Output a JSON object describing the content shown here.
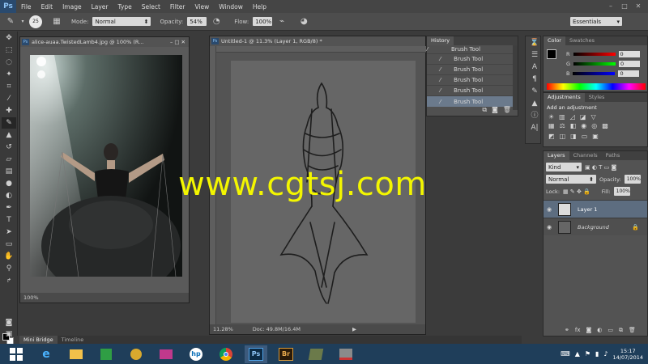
{
  "menubar": {
    "logo": "Ps",
    "items": [
      "File",
      "Edit",
      "Image",
      "Layer",
      "Type",
      "Select",
      "Filter",
      "View",
      "Window",
      "Help"
    ]
  },
  "options": {
    "brush_size": "25",
    "mode_label": "Mode:",
    "mode_value": "Normal",
    "opacity_label": "Opacity:",
    "opacity_value": "54%",
    "flow_label": "Flow:",
    "flow_value": "100%",
    "workspace": "Essentials"
  },
  "left_doc": {
    "title": "alice-auaa.TwistedLamb4.jpg @ 100% (R...",
    "zoom": "100%"
  },
  "main_doc": {
    "title": "Untitled-1 @ 11.3% (Layer 1, RGB/8) *",
    "zoom": "11.28%",
    "doc_info": "Doc: 49.8M/16.4M"
  },
  "watermark": "www.cgtsj.com",
  "history": {
    "title": "History",
    "items": [
      "Brush Tool",
      "Brush Tool",
      "Brush Tool",
      "Brush Tool",
      "Brush Tool",
      "Brush Tool"
    ]
  },
  "color_panel": {
    "tabs": [
      "Color",
      "Swatches"
    ],
    "r_label": "R",
    "g_label": "G",
    "b_label": "B",
    "r_value": "0",
    "g_value": "0",
    "b_value": "0"
  },
  "adjustments": {
    "tabs": [
      "Adjustments",
      "Styles"
    ],
    "heading": "Add an adjustment"
  },
  "layers": {
    "tabs": [
      "Layers",
      "Channels",
      "Paths"
    ],
    "filter": "Kind",
    "blend": "Normal",
    "opacity_label": "Opacity:",
    "opacity_value": "100%",
    "lock_label": "Lock:",
    "fill_label": "Fill:",
    "fill_value": "100%",
    "rows": [
      "Layer 1",
      "Background"
    ]
  },
  "bottom_tabs": [
    "Mini Bridge",
    "Timeline"
  ],
  "taskbar": {
    "time": "15:17",
    "date": "14/07/2014",
    "apps": [
      "ie-icon",
      "explorer-icon",
      "store-icon",
      "media-icon",
      "remote-icon",
      "hp-icon",
      "chrome-icon",
      "photoshop-icon",
      "bridge-icon",
      "app-icon",
      "app2-icon"
    ],
    "ps_label": "Ps",
    "br_label": "Br"
  }
}
